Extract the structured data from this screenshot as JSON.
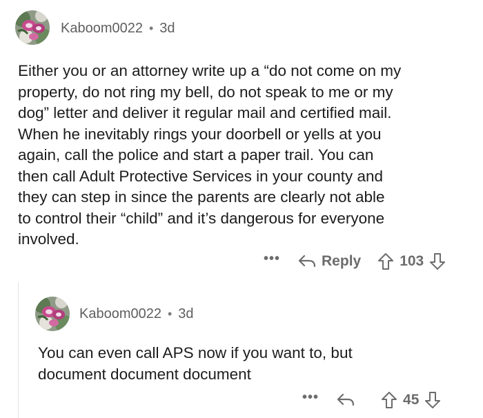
{
  "comments": [
    {
      "username": "Kaboom0022",
      "separator": "•",
      "time": "3d",
      "text": "Either you or an attorney write up a “do not come on my\nproperty, do not ring my bell, do not speak to me or my\ndog” letter and deliver it regular mail and certified mail.\nWhen he inevitably rings your doorbell or yells at you\nagain, call the police and start a paper trail. You can\nthen call Adult Protective Services in your county and\nthey can step in since the parents are clearly not able\nto control their “child” and it’s dangerous for everyone\ninvolved.",
      "more": "•••",
      "reply_label": "Reply",
      "score": "103",
      "icons": {
        "avatar": "avatar-flower-icon",
        "more": "more-dots-icon",
        "reply": "reply-arrow-icon",
        "upvote": "upvote-arrow-icon",
        "downvote": "downvote-arrow-icon"
      }
    },
    {
      "username": "Kaboom0022",
      "separator": "•",
      "time": "3d",
      "text": "You can even call APS now if you want to, but\ndocument document document",
      "more": "•••",
      "score": "45",
      "icons": {
        "avatar": "avatar-flower-icon",
        "more": "more-dots-icon",
        "reply": "reply-arrow-icon",
        "upvote": "upvote-arrow-icon",
        "downvote": "downvote-arrow-icon"
      }
    }
  ],
  "colors": {
    "text": "#1c1c1d",
    "meta": "#5e5e60",
    "action": "#6c6c6e",
    "thread_line": "#e3e3e3",
    "avatar_pink": "#c84b8e",
    "avatar_green": "#4f7d47"
  }
}
